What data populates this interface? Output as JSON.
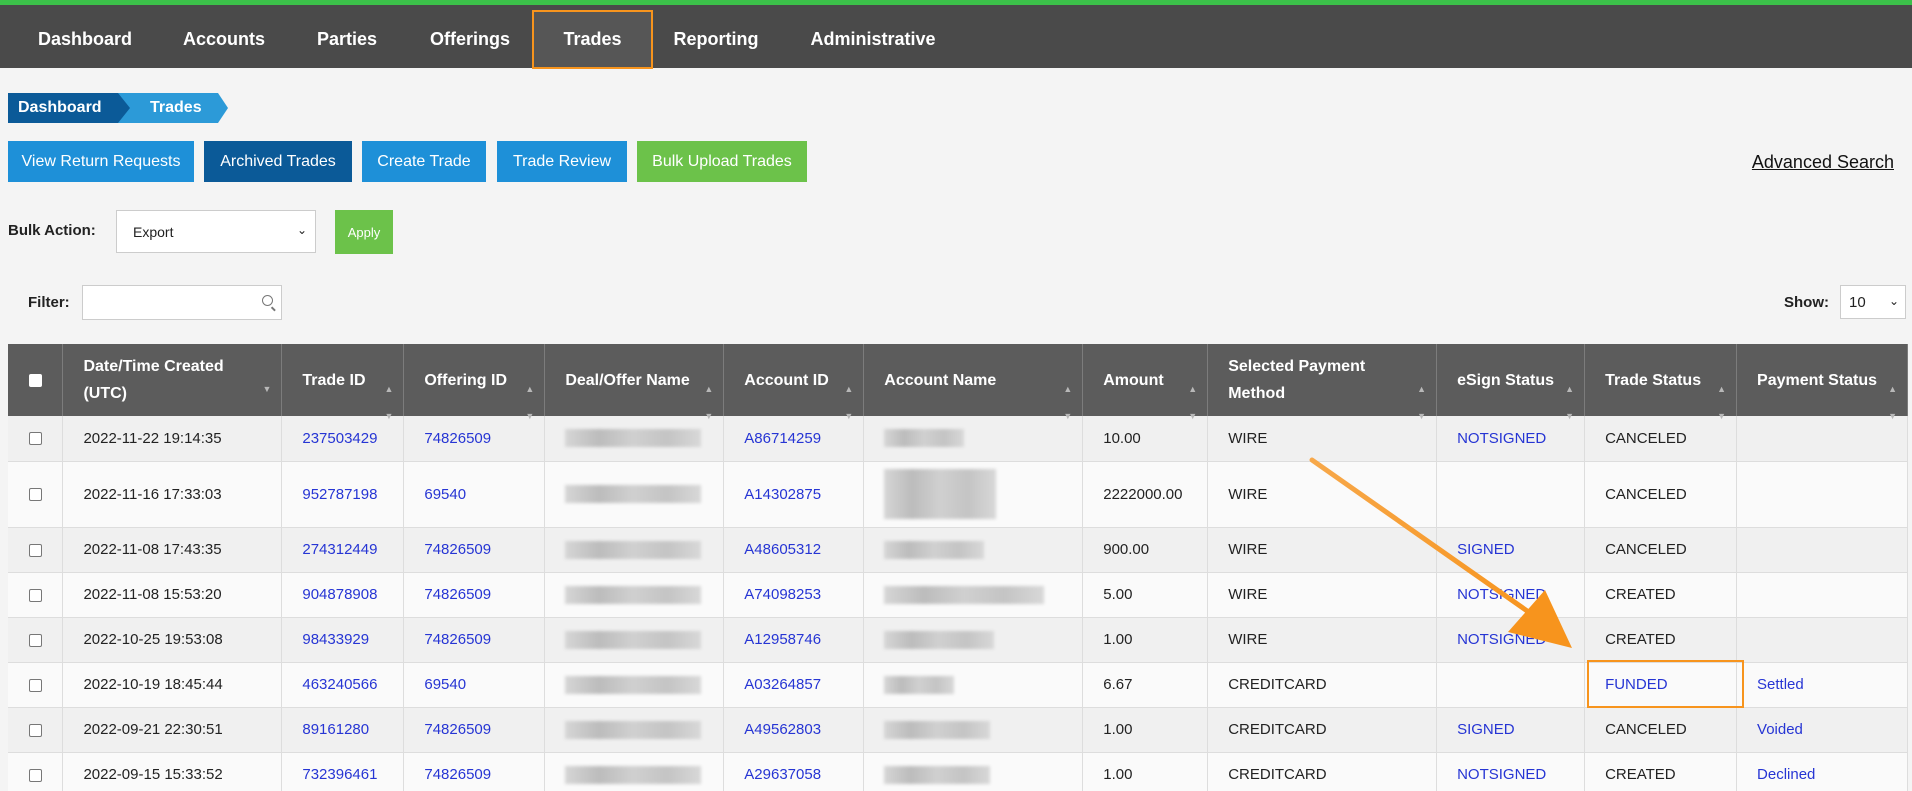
{
  "nav": {
    "items": [
      {
        "label": "Dashboard"
      },
      {
        "label": "Accounts"
      },
      {
        "label": "Parties"
      },
      {
        "label": "Offerings"
      },
      {
        "label": "Trades"
      },
      {
        "label": "Reporting"
      },
      {
        "label": "Administrative"
      }
    ],
    "active": "Trades",
    "accent_color": "#f7941d",
    "top_border_color": "#3cc14a"
  },
  "breadcrumb": [
    "Dashboard",
    "Trades"
  ],
  "buttons": {
    "view_return_requests": "View Return Requests",
    "archived_trades": "Archived Trades",
    "create_trade": "Create Trade",
    "trade_review": "Trade Review",
    "bulk_upload_trades": "Bulk Upload Trades"
  },
  "advanced_search": "Advanced Search",
  "bulk_action": {
    "label": "Bulk Action:",
    "selected": "Export",
    "apply": "Apply"
  },
  "filter": {
    "label": "Filter:",
    "value": ""
  },
  "show": {
    "label": "Show:",
    "selected": "10"
  },
  "table": {
    "headers": [
      "Date/Time Created (UTC)",
      "Trade ID",
      "Offering ID",
      "Deal/Offer Name",
      "Account ID",
      "Account Name",
      "Amount",
      "Selected Payment Method",
      "eSign Status",
      "Trade Status",
      "Payment Status"
    ],
    "rows": [
      {
        "date": "2022-11-22 19:14:35",
        "trade_id": "237503429",
        "offering_id": "74826509",
        "account_id": "A86714259",
        "amount": "10.00",
        "payment_method": "WIRE",
        "esign": "NOTSIGNED",
        "trade_status": "CANCELED",
        "payment_status": ""
      },
      {
        "date": "2022-11-16 17:33:03",
        "trade_id": "952787198",
        "offering_id": "69540",
        "account_id": "A14302875",
        "amount": "2222000.00",
        "payment_method": "WIRE",
        "esign": "",
        "trade_status": "CANCELED",
        "payment_status": ""
      },
      {
        "date": "2022-11-08 17:43:35",
        "trade_id": "274312449",
        "offering_id": "74826509",
        "account_id": "A48605312",
        "amount": "900.00",
        "payment_method": "WIRE",
        "esign": "SIGNED",
        "trade_status": "CANCELED",
        "payment_status": ""
      },
      {
        "date": "2022-11-08 15:53:20",
        "trade_id": "904878908",
        "offering_id": "74826509",
        "account_id": "A74098253",
        "amount": "5.00",
        "payment_method": "WIRE",
        "esign": "NOTSIGNED",
        "trade_status": "CREATED",
        "payment_status": ""
      },
      {
        "date": "2022-10-25 19:53:08",
        "trade_id": "98433929",
        "offering_id": "74826509",
        "account_id": "A12958746",
        "amount": "1.00",
        "payment_method": "WIRE",
        "esign": "NOTSIGNED",
        "trade_status": "CREATED",
        "payment_status": ""
      },
      {
        "date": "2022-10-19 18:45:44",
        "trade_id": "463240566",
        "offering_id": "69540",
        "account_id": "A03264857",
        "amount": "6.67",
        "payment_method": "CREDITCARD",
        "esign": "",
        "trade_status": "FUNDED",
        "payment_status": "Settled"
      },
      {
        "date": "2022-09-21 22:30:51",
        "trade_id": "89161280",
        "offering_id": "74826509",
        "account_id": "A49562803",
        "amount": "1.00",
        "payment_method": "CREDITCARD",
        "esign": "SIGNED",
        "trade_status": "CANCELED",
        "payment_status": "Voided"
      },
      {
        "date": "2022-09-15 15:33:52",
        "trade_id": "732396461",
        "offering_id": "74826509",
        "account_id": "A29637058",
        "amount": "1.00",
        "payment_method": "CREDITCARD",
        "esign": "NOTSIGNED",
        "trade_status": "CREATED",
        "payment_status": "Declined"
      }
    ]
  }
}
